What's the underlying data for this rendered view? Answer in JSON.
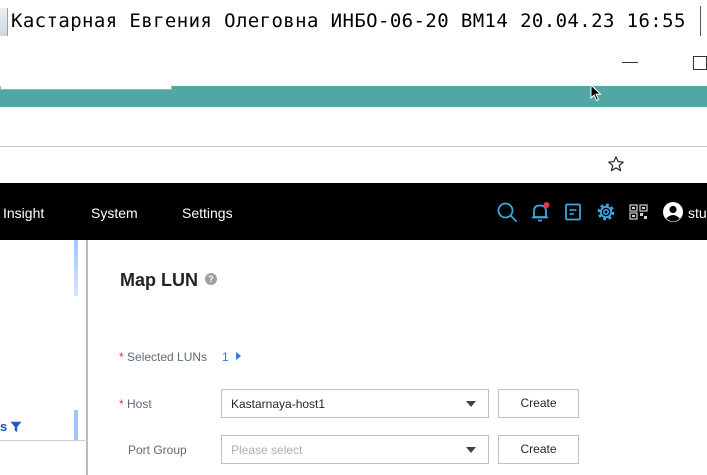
{
  "overlay": {
    "text": "Кастарная Евгения Олеговна ИНБО-06-20 ВМ14 20.04.23 16:55"
  },
  "header": {
    "nav_items": [
      "Insight",
      "System",
      "Settings"
    ],
    "icons": [
      "search-icon",
      "bell-icon",
      "task-icon",
      "gear-icon",
      "qr-code-icon",
      "user-avatar-icon"
    ],
    "user_label": "stu",
    "alert_color": "#e5324a"
  },
  "left_panel": {
    "label": "s"
  },
  "dialog": {
    "title": "Map LUN",
    "help_icon": "?",
    "selected_luns": {
      "required_mark": "*",
      "label": "Selected LUNs",
      "count": "1"
    },
    "host": {
      "required_mark": "*",
      "label": "Host",
      "value": "Kastarnaya-host1",
      "create_label": "Create"
    },
    "port_group": {
      "label": "Port Group",
      "placeholder": "Please select",
      "create_label": "Create"
    }
  },
  "colors": {
    "tab_strip": "#52a7a4",
    "app_bar": "#000000",
    "link_blue": "#2d7be5",
    "required_red": "#e0323c"
  }
}
